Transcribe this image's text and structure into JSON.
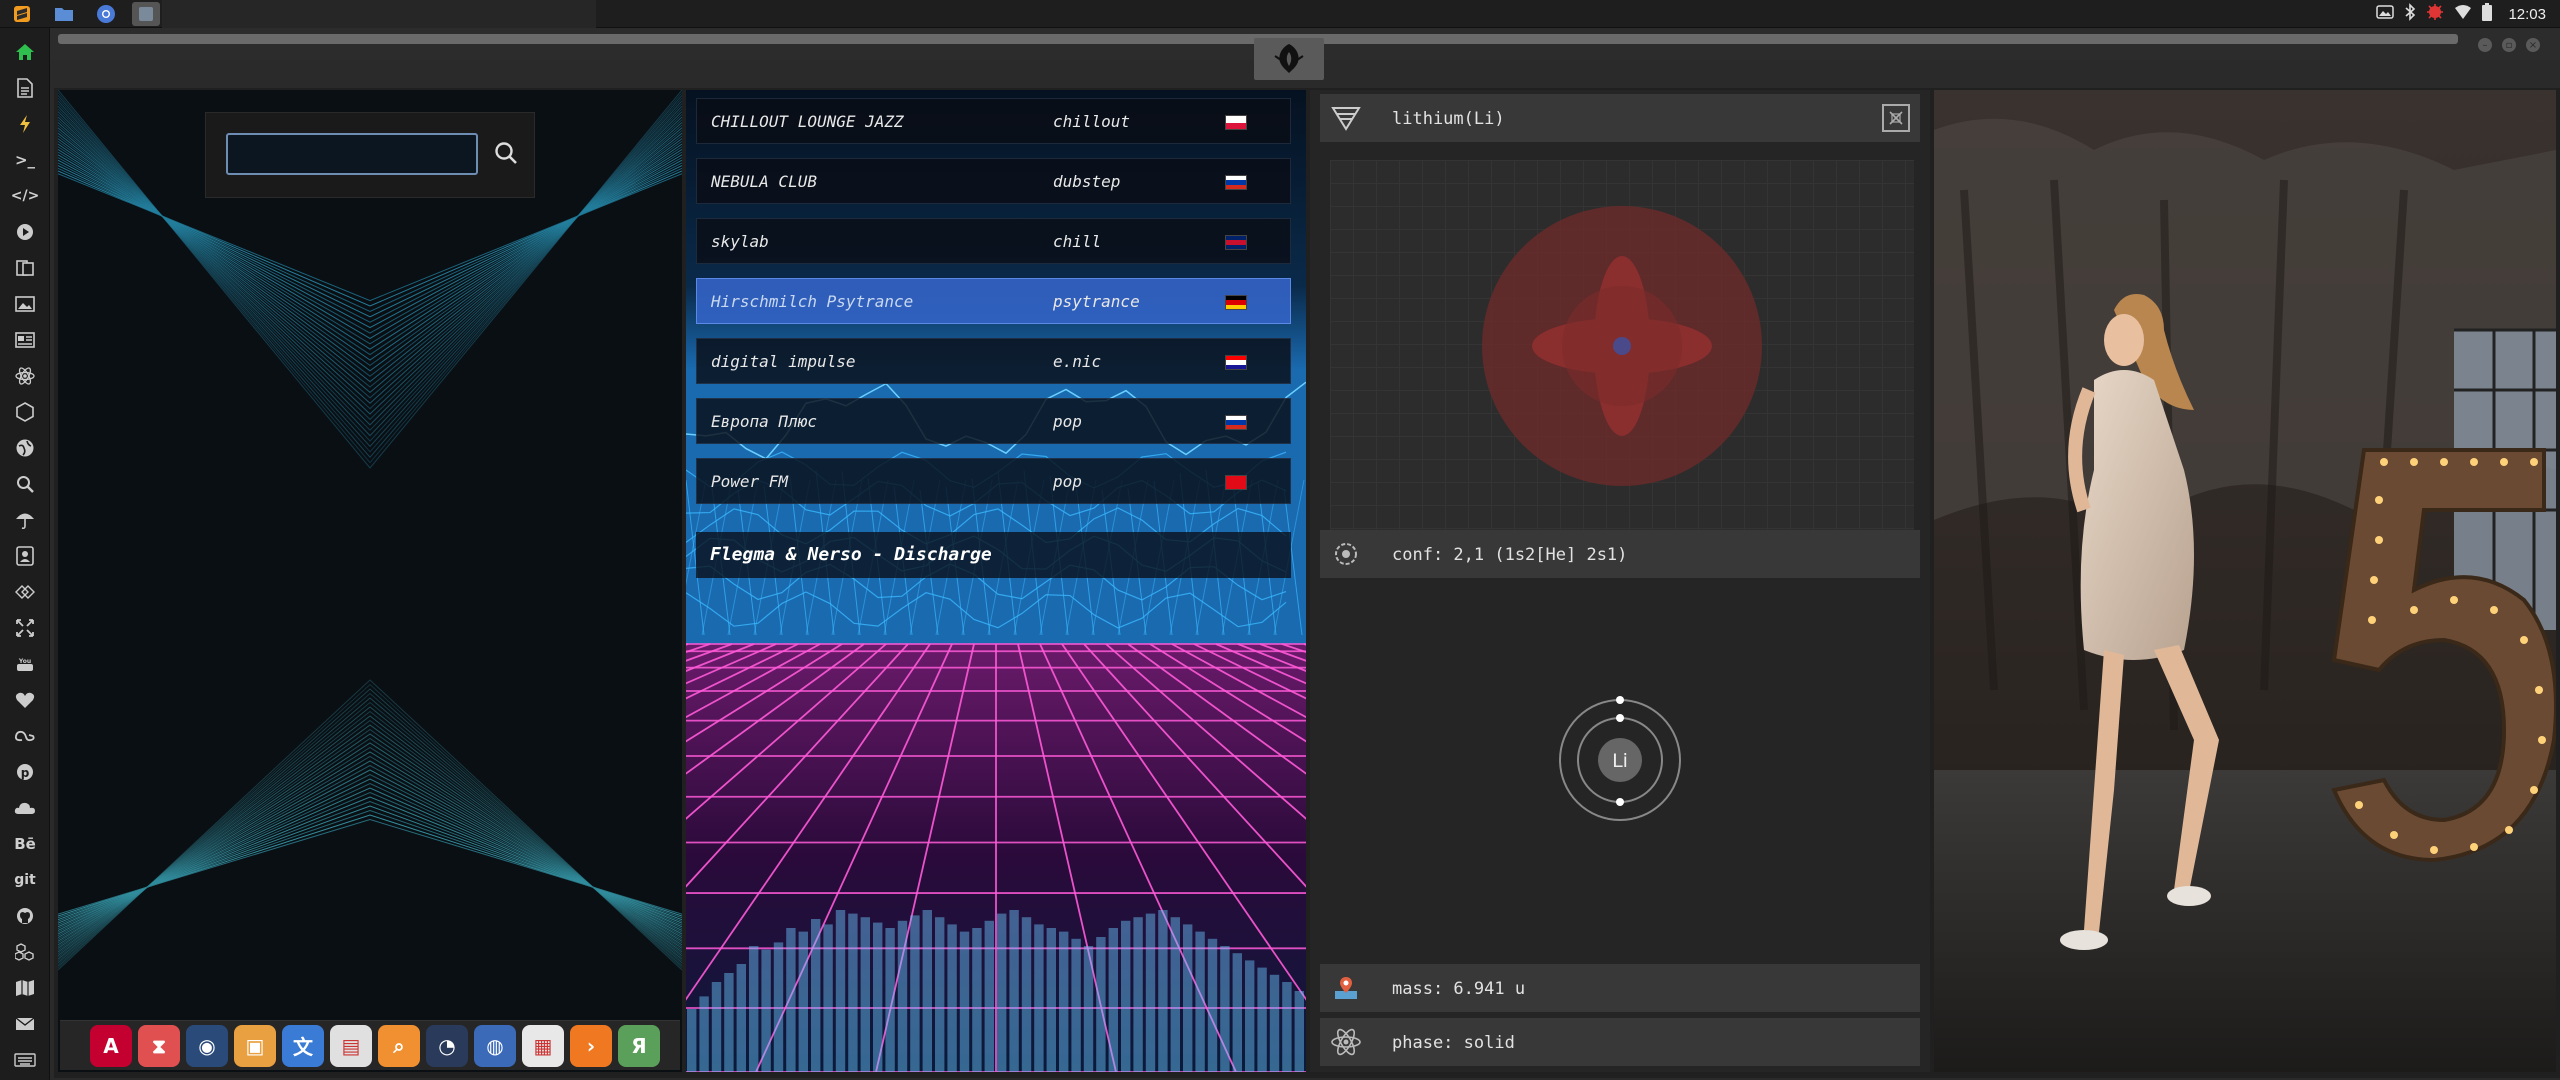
{
  "topbar": {
    "clock": "12:03",
    "launchers": [
      {
        "icon": "sublime-text-icon"
      },
      {
        "icon": "files-folder-icon"
      },
      {
        "icon": "chrome-browser-icon"
      },
      {
        "icon": "active-window-icon"
      }
    ],
    "tray": [
      "screenshot-icon",
      "bluetooth-icon",
      "red-bug-icon",
      "wifi-icon",
      "battery-icon"
    ]
  },
  "leftbar": {
    "items": [
      {
        "icon": "home-icon"
      },
      {
        "icon": "document-icon"
      },
      {
        "icon": "lightning-icon"
      },
      {
        "icon": "terminal-icon",
        "glyph": ">_"
      },
      {
        "icon": "code-icon",
        "glyph": "</>"
      },
      {
        "icon": "play-icon"
      },
      {
        "icon": "books-icon"
      },
      {
        "icon": "image-icon"
      },
      {
        "icon": "newspaper-icon"
      },
      {
        "icon": "react-icon"
      },
      {
        "icon": "hexagon-icon"
      },
      {
        "icon": "globe-icon"
      },
      {
        "icon": "search-icon"
      },
      {
        "icon": "umbrella-icon"
      },
      {
        "icon": "contact-icon"
      },
      {
        "icon": "git-diff-icon"
      },
      {
        "icon": "expand-icon"
      },
      {
        "icon": "youtube-icon"
      },
      {
        "icon": "heart-icon"
      },
      {
        "icon": "lastfm-icon"
      },
      {
        "icon": "pinterest-icon"
      },
      {
        "icon": "cloud-icon"
      },
      {
        "icon": "behance-icon",
        "glyph": "Bē"
      },
      {
        "icon": "git-icon",
        "glyph": "git"
      },
      {
        "icon": "github-icon"
      },
      {
        "icon": "cubes-icon"
      },
      {
        "icon": "map-icon"
      },
      {
        "icon": "mail-icon"
      },
      {
        "icon": "keyboard-icon"
      }
    ]
  },
  "search": {
    "placeholder": "",
    "value": ""
  },
  "dock": {
    "apps": [
      {
        "icon": "angular-app-icon",
        "color": "#c3002f",
        "glyph": "A"
      },
      {
        "icon": "hourglass-app-icon",
        "color": "#e05050",
        "glyph": "⧗"
      },
      {
        "icon": "earth-app-icon",
        "color": "#2a4a7a",
        "glyph": "◉"
      },
      {
        "icon": "photos-app-icon",
        "color": "#e8a040",
        "glyph": "▣"
      },
      {
        "icon": "translate-app-icon",
        "color": "#3a7bd5",
        "glyph": "文"
      },
      {
        "icon": "calendar-news-app-icon",
        "color": "#e0e0e0",
        "glyph": "▤"
      },
      {
        "icon": "search-app-icon",
        "color": "#f09030",
        "glyph": "⌕"
      },
      {
        "icon": "clock-app-icon",
        "color": "#2a3a5a",
        "glyph": "◔"
      },
      {
        "icon": "web-globe-app-icon",
        "color": "#3a6ab8",
        "glyph": "◍"
      },
      {
        "icon": "calendar-app-icon",
        "color": "#e8e8e8",
        "glyph": "▦"
      },
      {
        "icon": "forward-app-icon",
        "color": "#f07820",
        "glyph": "›"
      },
      {
        "icon": "yandex-app-icon",
        "color": "#5aa05a",
        "glyph": "Я"
      }
    ]
  },
  "radio": {
    "stations": [
      {
        "name": "CHILLOUT LOUNGE JAZZ",
        "genre": "chillout",
        "flag": [
          "#ffffff",
          "#dc143c"
        ]
      },
      {
        "name": "NEBULA CLUB",
        "genre": "dubstep",
        "flag": [
          "#ffffff",
          "#0039a6",
          "#d52b1e"
        ]
      },
      {
        "name": "skylab",
        "genre": "chill",
        "flag": [
          "#012169",
          "#c8102e",
          "#012169"
        ]
      },
      {
        "name": "Hirschmilch Psytrance",
        "genre": "psytrance",
        "flag": [
          "#000000",
          "#dd0000",
          "#ffce00"
        ]
      },
      {
        "name": "digital impulse",
        "genre": "e.nic",
        "flag": [
          "#ff0000",
          "#ffffff",
          "#171796"
        ]
      },
      {
        "name": "Европа Плюс",
        "genre": "pop",
        "flag": [
          "#ffffff",
          "#0039a6",
          "#d52b1e"
        ]
      },
      {
        "name": "Power FM",
        "genre": "pop",
        "flag": [
          "#e30a17",
          "#e30a17"
        ]
      }
    ],
    "active_index": 3,
    "now_playing": "Flegma & Nerso - Discharge",
    "visualizer_levels": [
      0.35,
      0.42,
      0.5,
      0.55,
      0.6,
      0.7,
      0.68,
      0.72,
      0.8,
      0.78,
      0.85,
      0.82,
      0.9,
      0.88,
      0.86,
      0.83,
      0.8,
      0.84,
      0.87,
      0.9,
      0.86,
      0.82,
      0.78,
      0.8,
      0.84,
      0.88,
      0.9,
      0.86,
      0.82,
      0.8,
      0.78,
      0.74,
      0.7,
      0.75,
      0.8,
      0.84,
      0.86,
      0.88,
      0.9,
      0.86,
      0.82,
      0.78,
      0.74,
      0.7,
      0.66,
      0.62,
      0.58,
      0.54,
      0.5,
      0.45
    ]
  },
  "element": {
    "name": "lithium(Li)",
    "conf": "conf: 2,1 (1s2[He] 2s1)",
    "mass": "mass: 6.941 u",
    "phase": "phase: solid",
    "symbol": "Li"
  }
}
